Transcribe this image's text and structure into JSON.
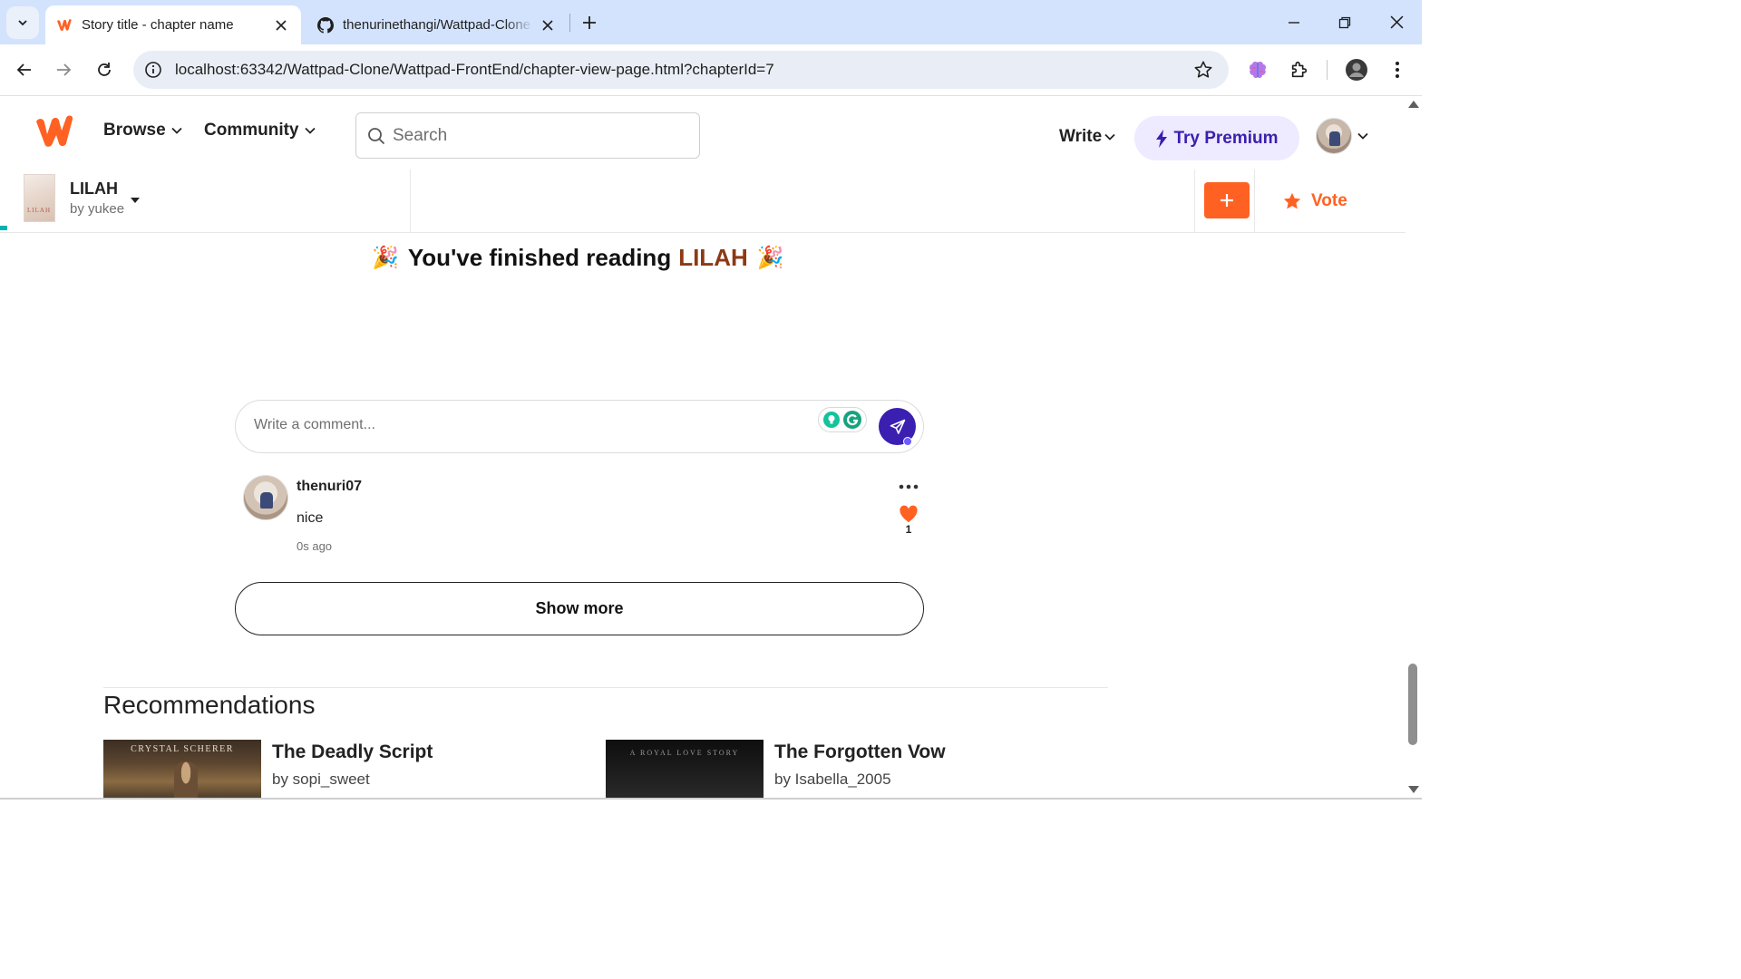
{
  "browser": {
    "tabs": [
      {
        "title": "Story title - chapter name",
        "active": true,
        "favicon": "wattpad-w-icon"
      },
      {
        "title": "thenurinethangi/Wattpad-Clone",
        "active": false,
        "favicon": "github-icon"
      }
    ],
    "url": "localhost:63342/Wattpad-Clone/Wattpad-FrontEnd/chapter-view-page.html?chapterId=7"
  },
  "header": {
    "nav": {
      "browse": "Browse",
      "community": "Community"
    },
    "search_placeholder": "Search",
    "write": "Write",
    "premium": "Try Premium",
    "accent_color": "#ff6122",
    "premium_color": "#3a1fb0"
  },
  "story": {
    "title": "LILAH",
    "author": "by yukee",
    "cover_text": "LILAH",
    "vote": "Vote"
  },
  "finished": {
    "prefix": "You've finished reading",
    "title": "LILAH",
    "emoji": "🎉"
  },
  "comment_input": {
    "placeholder": "Write a comment..."
  },
  "comments": [
    {
      "user": "thenuri07",
      "text": "nice",
      "time": "0s ago",
      "likes": "1"
    }
  ],
  "show_more": "Show more",
  "recommendations": {
    "heading": "Recommendations",
    "items": [
      {
        "title": "The Deadly Script",
        "author": "by sopi_sweet",
        "cover_text": "CRYSTAL SCHERER"
      },
      {
        "title": "The Forgotten Vow",
        "author": "by Isabella_2005",
        "cover_text": "A ROYAL LOVE STORY"
      }
    ]
  }
}
